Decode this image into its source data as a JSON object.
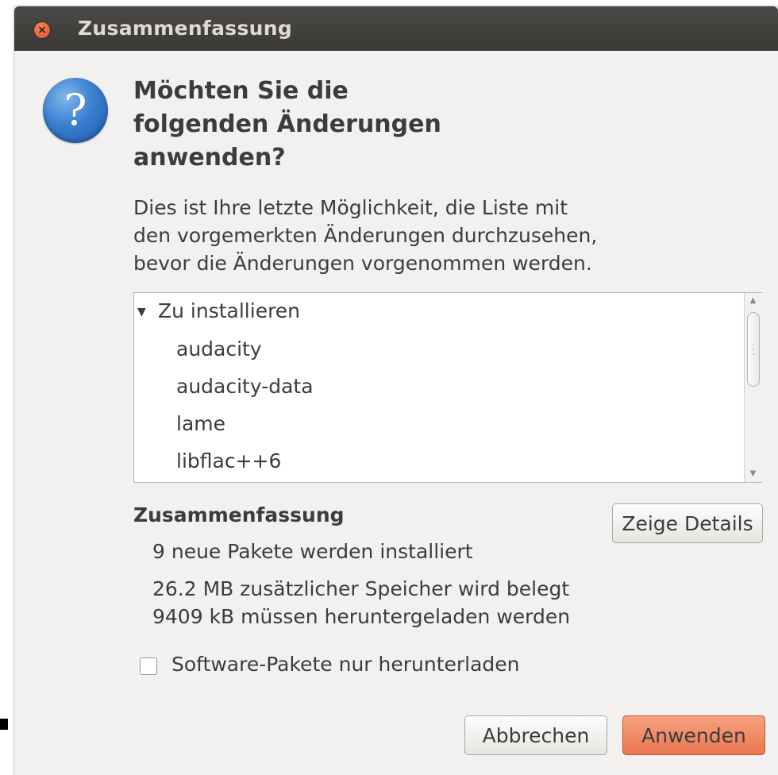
{
  "window": {
    "title": "Zusammenfassung"
  },
  "dialog": {
    "heading_lines": [
      "Möchten Sie die",
      "folgenden Änderungen",
      "anwenden?"
    ],
    "description_lines": [
      "Dies ist Ihre letzte Möglichkeit, die Liste mit",
      "den vorgemerkten Änderungen durchzusehen,",
      "bevor die Änderungen vorgenommen werden."
    ],
    "icon": "question-icon"
  },
  "changes_list": {
    "group_label": "Zu installieren",
    "expander_glyph": "▼",
    "items": [
      "audacity",
      "audacity-data",
      "lame",
      "libflac++6"
    ]
  },
  "summary": {
    "title": "Zusammenfassung",
    "details_button": "Zeige Details",
    "lines": [
      "9 neue Pakete werden installiert",
      "26.2 MB zusätzlicher Speicher wird belegt",
      "9409 kB müssen heruntergeladen werden"
    ]
  },
  "download_only": {
    "label": "Software-Pakete nur herunterladen",
    "checked": false
  },
  "buttons": {
    "cancel": "Abbrechen",
    "apply": "Anwenden"
  },
  "colors": {
    "titlebar": "#3c3b37",
    "apply_button": "#ef8560",
    "icon_blue": "#3b7fd0",
    "window_bg": "#f2f1f0"
  }
}
